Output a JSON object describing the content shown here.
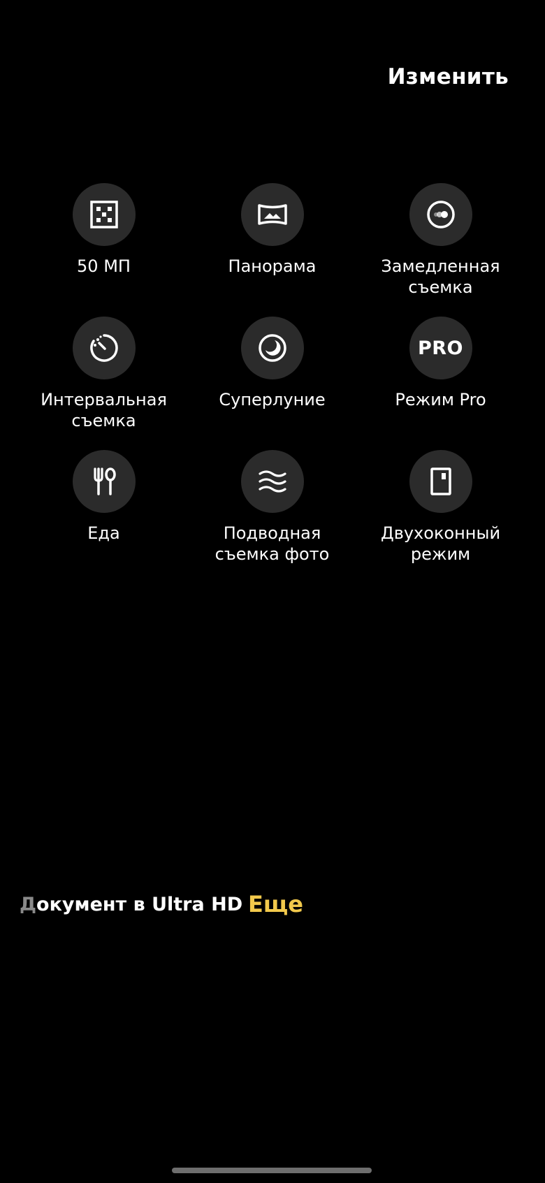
{
  "header": {
    "edit_label": "Изменить"
  },
  "modes": [
    {
      "label": "50 МП",
      "icon": "grid-dots-icon"
    },
    {
      "label": "Панорама",
      "icon": "panorama-icon"
    },
    {
      "label": "Замедленная\nсъемка",
      "icon": "slow-motion-icon"
    },
    {
      "label": "Интервальная\nсъемка",
      "icon": "timelapse-icon"
    },
    {
      "label": "Суперлуние",
      "icon": "moon-icon"
    },
    {
      "label": "Режим Pro",
      "icon": "pro-icon",
      "icon_text": "PRO"
    },
    {
      "label": "Еда",
      "icon": "food-icon"
    },
    {
      "label": "Подводная\nсъемка фото",
      "icon": "water-waves-icon"
    },
    {
      "label": "Двухоконный\nрежим",
      "icon": "dual-window-icon"
    }
  ],
  "bottom": {
    "current_mode_first": "Д",
    "current_mode_rest": "окумент в Ultra HD",
    "more_label": "Еще"
  },
  "colors": {
    "background": "#000000",
    "icon_circle": "#2b2b2b",
    "accent": "#f2c94c"
  }
}
